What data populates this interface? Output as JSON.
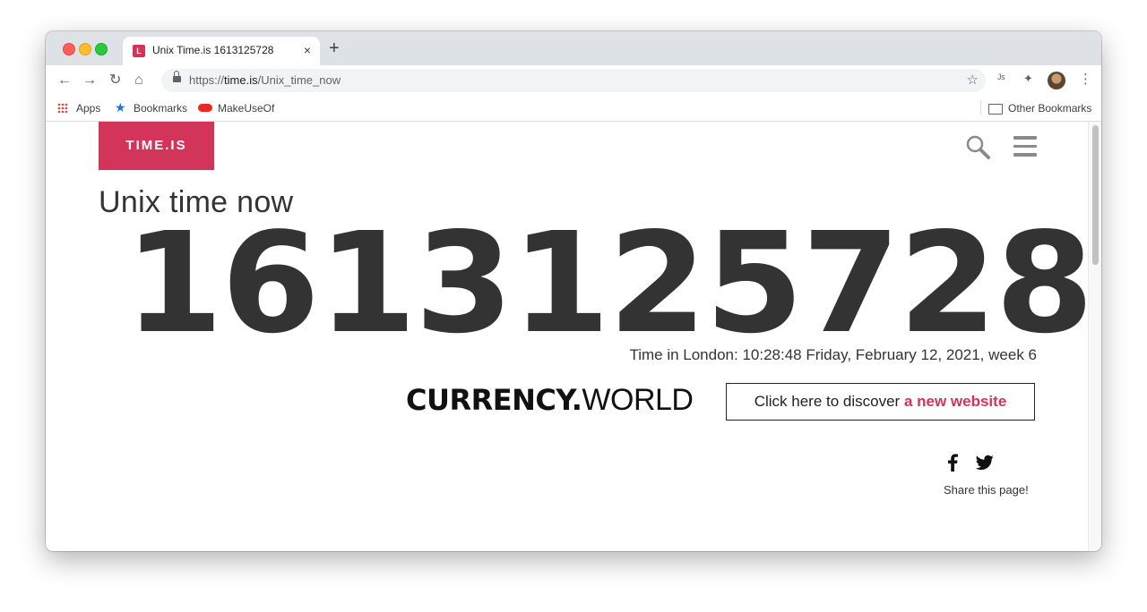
{
  "browser": {
    "tab_title": "Unix Time.is 1613125728",
    "tab_favicon_letter": "L",
    "new_tab_symbol": "+",
    "close_symbol": "×",
    "url_prefix": "https://",
    "url_host": "time.is",
    "url_path": "/Unix_time_now",
    "bookmarks": [
      "Apps",
      "Bookmarks",
      "MakeUseOf"
    ],
    "other_bookmarks": "Other Bookmarks"
  },
  "site": {
    "logo": "TIME.IS",
    "heading": "Unix time now",
    "unix_time": "1613125728",
    "london_time": "Time in London: 10:28:48 Friday, February 12, 2021, week 6",
    "ad": {
      "brand_bold": "CURRENCY.",
      "brand_thin": "WORLD",
      "button_prefix": "Click here to discover ",
      "button_accent": "a new website"
    },
    "share_text": "Share this page!"
  },
  "colors": {
    "brand": "#d3345a",
    "text": "#333333"
  },
  "icons": [
    "search-icon",
    "menu-icon",
    "facebook-icon",
    "twitter-icon",
    "lock-icon",
    "star-icon",
    "extensions-icon",
    "kebab-menu-icon"
  ]
}
